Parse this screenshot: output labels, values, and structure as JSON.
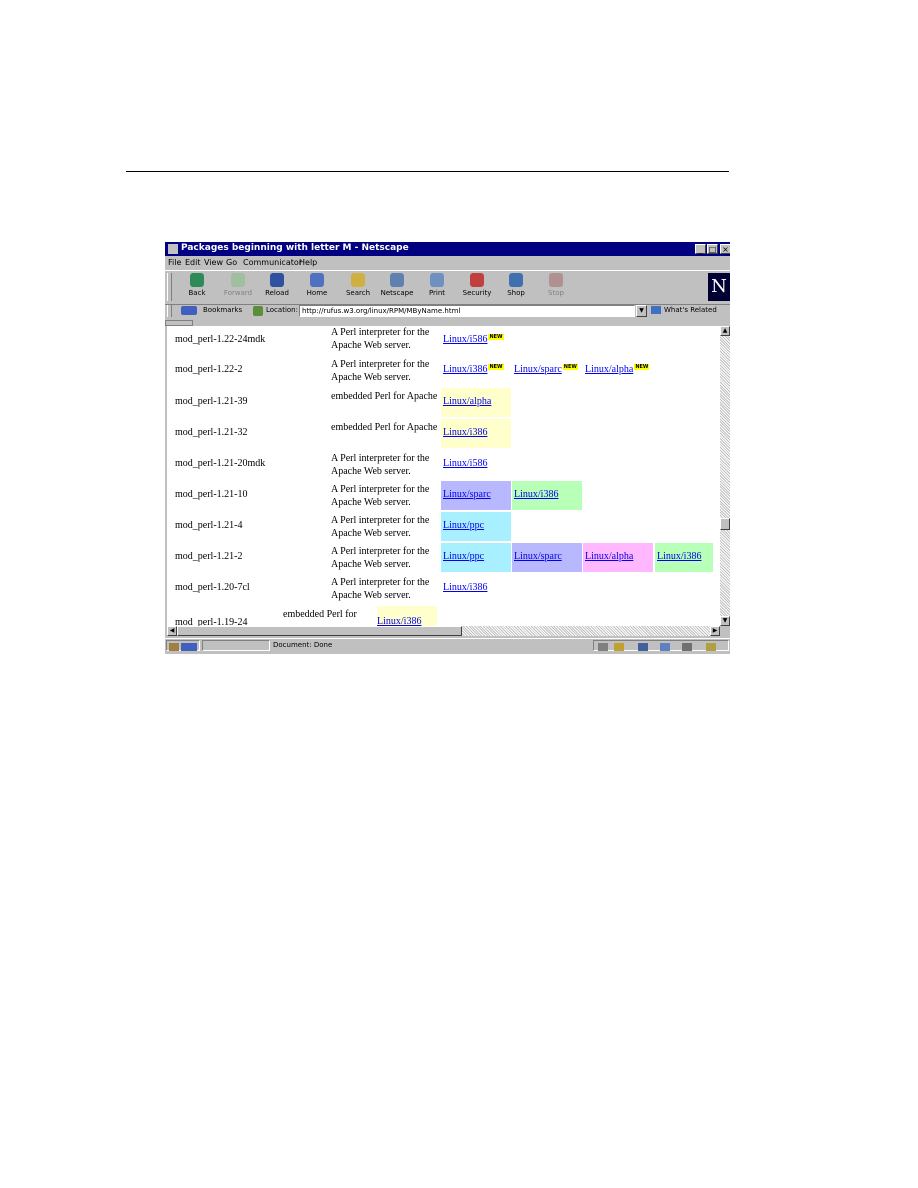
{
  "window": {
    "title": "Packages beginning with letter M - Netscape"
  },
  "menu": [
    "File",
    "Edit",
    "View",
    "Go",
    "Communicator",
    "Help"
  ],
  "toolbar": {
    "back": "Back",
    "forward": "Forward",
    "reload": "Reload",
    "home": "Home",
    "search": "Search",
    "netscape": "Netscape",
    "print": "Print",
    "security": "Security",
    "shop": "Shop",
    "stop": "Stop",
    "logo": "N"
  },
  "location": {
    "bookmarks_label": "Bookmarks",
    "location_label": "Location:",
    "url": "http://rufus.w3.org/linux/RPM/MByName.html",
    "whats_related": "What's Related"
  },
  "colors": {
    "yellow": "#ffffcc",
    "purple": "#b8b8ff",
    "green": "#b8ffb8",
    "cyan": "#a8f0ff",
    "pink": "#ffb8ff"
  },
  "packages": [
    {
      "name": "mod_perl-1.22-24mdk",
      "desc": "A Perl interpreter for the Apache Web server.",
      "builds": [
        {
          "label": "Linux/i586",
          "new": "NEW",
          "color": "#ffffff"
        }
      ]
    },
    {
      "name": "mod_perl-1.22-2",
      "desc": "A Perl interpreter for the Apache Web server.",
      "builds": [
        {
          "label": "Linux/i386",
          "new": "NEW",
          "color": "#ffffff"
        },
        {
          "label": "Linux/sparc",
          "new": "NEW",
          "color": "#ffffff"
        },
        {
          "label": "Linux/alpha",
          "new": "NEW",
          "color": "#ffffff"
        }
      ]
    },
    {
      "name": "mod_perl-1.21-39",
      "desc": "embedded Perl for Apache",
      "builds": [
        {
          "label": "Linux/alpha",
          "new": "",
          "color": "#ffffcc"
        }
      ]
    },
    {
      "name": "mod_perl-1.21-32",
      "desc": "embedded Perl for Apache",
      "builds": [
        {
          "label": "Linux/i386",
          "new": "",
          "color": "#ffffcc"
        }
      ]
    },
    {
      "name": "mod_perl-1.21-20mdk",
      "desc": "A Perl interpreter for the Apache Web server.",
      "builds": [
        {
          "label": "Linux/i586",
          "new": "",
          "color": "#ffffff"
        }
      ]
    },
    {
      "name": "mod_perl-1.21-10",
      "desc": "A Perl interpreter for the Apache Web server.",
      "builds": [
        {
          "label": "Linux/sparc",
          "new": "",
          "color": "#b8b8ff"
        },
        {
          "label": "Linux/i386",
          "new": "",
          "color": "#b8ffb8"
        }
      ]
    },
    {
      "name": "mod_perl-1.21-4",
      "desc": "A Perl interpreter for the Apache Web server.",
      "builds": [
        {
          "label": "Linux/ppc",
          "new": "",
          "color": "#a8f0ff"
        }
      ]
    },
    {
      "name": "mod_perl-1.21-2",
      "desc": "A Perl interpreter for the Apache Web server.",
      "builds": [
        {
          "label": "Linux/ppc",
          "new": "",
          "color": "#a8f0ff"
        },
        {
          "label": "Linux/sparc",
          "new": "",
          "color": "#b8b8ff"
        },
        {
          "label": "Linux/alpha",
          "new": "",
          "color": "#ffb8ff"
        },
        {
          "label": "Linux/i386",
          "new": "",
          "color": "#b8ffb8"
        }
      ]
    },
    {
      "name": "mod_perl-1.20-7cl",
      "desc": "A Perl interpreter for the Apache Web server.",
      "builds": [
        {
          "label": "Linux/i386",
          "new": "",
          "color": "#ffffff"
        }
      ]
    },
    {
      "name": "mod_perl-1.19-24",
      "desc": "embedded Perl for",
      "builds": [
        {
          "label": "Linux/i386",
          "new": "",
          "color": "#ffffcc"
        }
      ]
    }
  ],
  "status": {
    "text": "Document: Done"
  }
}
